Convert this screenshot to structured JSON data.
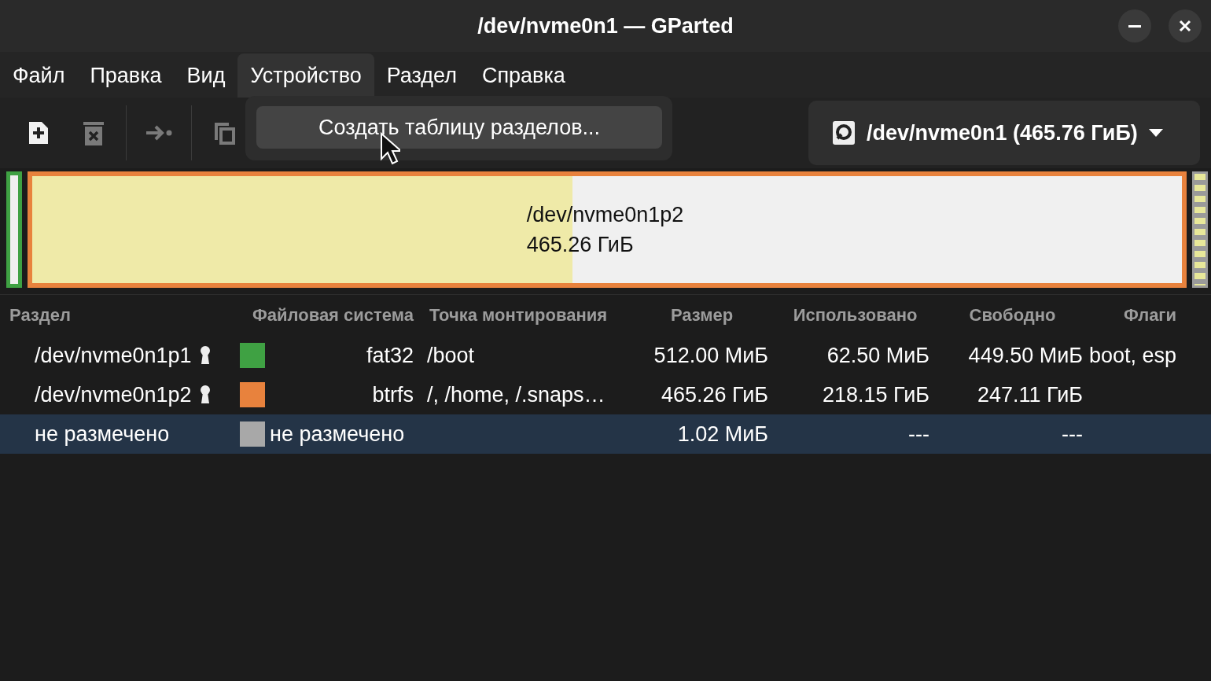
{
  "window": {
    "title": "/dev/nvme0n1 — GParted"
  },
  "menu": [
    {
      "label": "Файл",
      "selected": false
    },
    {
      "label": "Правка",
      "selected": false
    },
    {
      "label": "Вид",
      "selected": false
    },
    {
      "label": "Устройство",
      "selected": true
    },
    {
      "label": "Раздел",
      "selected": false
    },
    {
      "label": "Справка",
      "selected": false
    }
  ],
  "open_menu": {
    "items": [
      "Создать таблицу разделов..."
    ]
  },
  "toolbar": [
    {
      "kind": "new",
      "disabled": false
    },
    {
      "kind": "delete",
      "disabled": true
    },
    {
      "kind": "separator"
    },
    {
      "kind": "apply",
      "disabled": true
    },
    {
      "kind": "separator"
    },
    {
      "kind": "copy",
      "disabled": true
    }
  ],
  "device_selector": {
    "label": "/dev/nvme0n1 (465.76 ГиБ)"
  },
  "disk_map": {
    "segments": [
      {
        "kind": "small",
        "color": "#3fa143"
      },
      {
        "kind": "large",
        "color": "#e8823d",
        "level": 0.47,
        "name": "/dev/nvme0n1p2",
        "size": "465.26 ГиБ"
      },
      {
        "kind": "unallocated",
        "color": "#9a9a9a"
      }
    ]
  },
  "table": {
    "columns": [
      "Раздел",
      "Файловая система",
      "Точка монтирования",
      "Размер",
      "Использовано",
      "Свободно",
      "Флаги"
    ],
    "rows": [
      {
        "partition": "/dev/nvme0n1p1",
        "locked": true,
        "color": "#3fa143",
        "filesystem": "fat32",
        "mount": "/boot",
        "size": "512.00 МиБ",
        "used": "62.50 МиБ",
        "free": "449.50 МиБ",
        "flags": "boot, esp",
        "selected": false
      },
      {
        "partition": "/dev/nvme0n1p2",
        "locked": true,
        "color": "#e8823d",
        "filesystem": "btrfs",
        "mount": "/, /home, /.snaps…",
        "size": "465.26 ГиБ",
        "used": "218.15 ГиБ",
        "free": "247.11 ГиБ",
        "selected": false
      },
      {
        "partition": "не размечено",
        "locked": false,
        "color": "#a8a8a8",
        "filesystem": "не размечено",
        "size": "1.02 МиБ",
        "used": "---",
        "free": "---",
        "selected": true
      }
    ]
  }
}
